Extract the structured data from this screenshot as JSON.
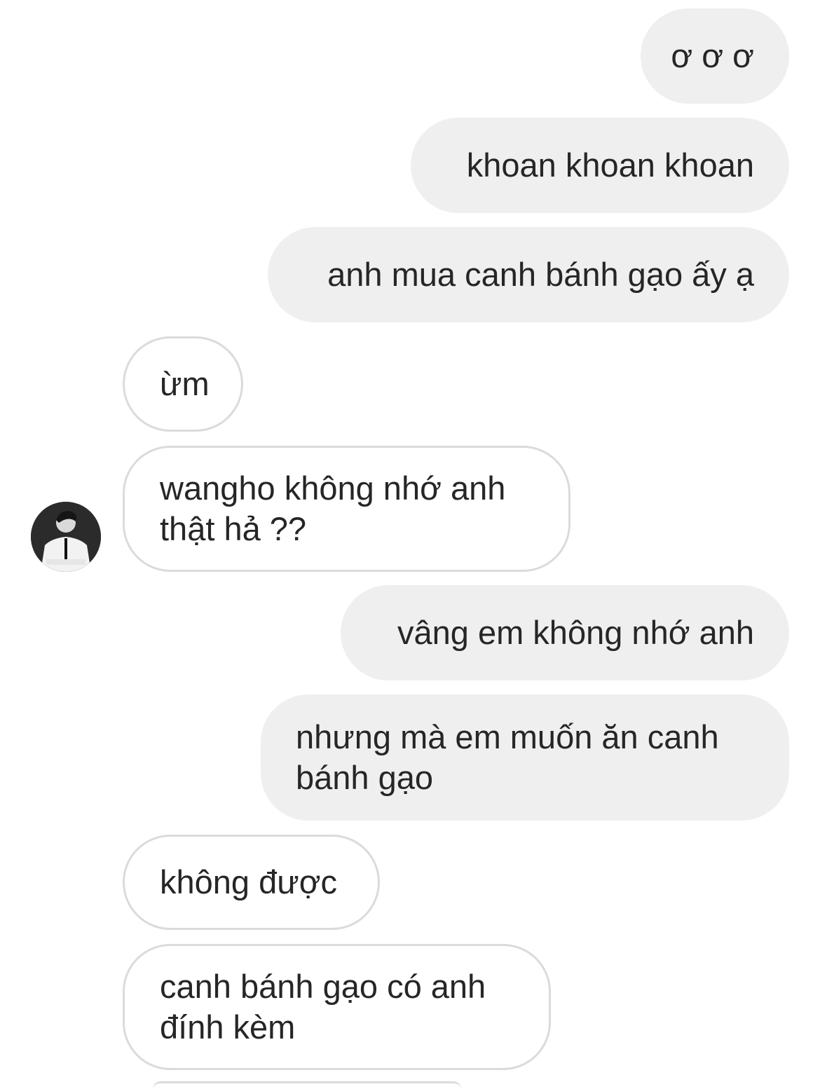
{
  "messages": [
    {
      "side": "out",
      "text": "ơ ơ ơ"
    },
    {
      "side": "out",
      "text": "khoan khoan khoan"
    },
    {
      "side": "out",
      "text": "anh mua canh bánh gạo ấy ạ"
    },
    {
      "side": "in",
      "text": "ừm"
    },
    {
      "side": "in",
      "line1": "wangho không nhớ anh",
      "line2": "thật hả ??"
    },
    {
      "side": "out",
      "text": "vâng em không nhớ anh"
    },
    {
      "side": "out",
      "line1": "nhưng mà em muốn ăn canh",
      "line2": "bánh gạo"
    },
    {
      "side": "in",
      "text": "không được"
    },
    {
      "side": "in",
      "line1": "canh bánh gạo có anh",
      "line2": "đính kèm"
    }
  ],
  "colors": {
    "outgoing_bubble": "#efefef",
    "incoming_border": "#dbdbdb",
    "text": "#262626"
  },
  "avatar": {
    "icon": "profile-photo-avatar"
  }
}
